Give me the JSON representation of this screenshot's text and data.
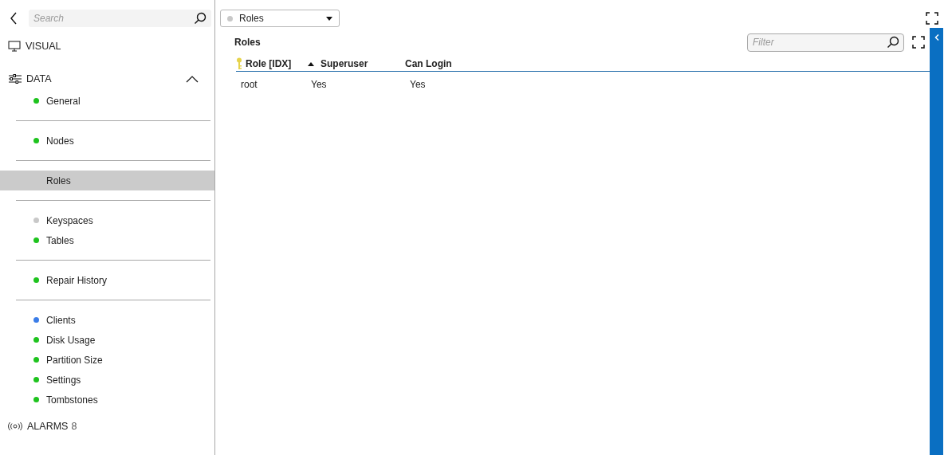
{
  "sidebar": {
    "search": {
      "placeholder": "Search"
    },
    "sections": [
      {
        "kind": "visual",
        "label": "VISUAL"
      },
      {
        "kind": "data",
        "label": "DATA",
        "expanded": true
      }
    ],
    "groups": [
      [
        {
          "label": "General",
          "selected": false,
          "color": "#1ec31e"
        }
      ],
      [
        {
          "label": "Nodes",
          "selected": false,
          "color": "#1ec31e"
        }
      ],
      [
        {
          "label": "Roles",
          "selected": true
        }
      ],
      [
        {
          "label": "Keyspaces",
          "selected": false,
          "color": "#c8c8c8"
        },
        {
          "label": "Tables",
          "selected": false,
          "color": "#1ec31e"
        }
      ],
      [
        {
          "label": "Repair History",
          "selected": false,
          "color": "#1ec31e"
        }
      ],
      [
        {
          "label": "Clients",
          "selected": false,
          "color": "#3b7de8"
        },
        {
          "label": "Disk Usage",
          "selected": false,
          "color": "#1ec31e"
        },
        {
          "label": "Partition Size",
          "selected": false,
          "color": "#1ec31e"
        },
        {
          "label": "Settings",
          "selected": false,
          "color": "#1ec31e"
        },
        {
          "label": "Tombstones",
          "selected": false,
          "color": "#1ec31e"
        }
      ]
    ],
    "alarms": {
      "label": "ALARMS",
      "count": "8"
    }
  },
  "view_select": {
    "value": "Roles"
  },
  "panel": {
    "title": "Roles",
    "filter": {
      "placeholder": "Filter"
    },
    "table": {
      "columns": [
        {
          "label": "Role [IDX]",
          "kind": "key"
        },
        {
          "label": "Superuser",
          "kind": "sorted"
        },
        {
          "label": "Can Login",
          "kind": "plain"
        }
      ],
      "rows": [
        [
          "root",
          "Yes",
          "Yes"
        ]
      ]
    }
  }
}
